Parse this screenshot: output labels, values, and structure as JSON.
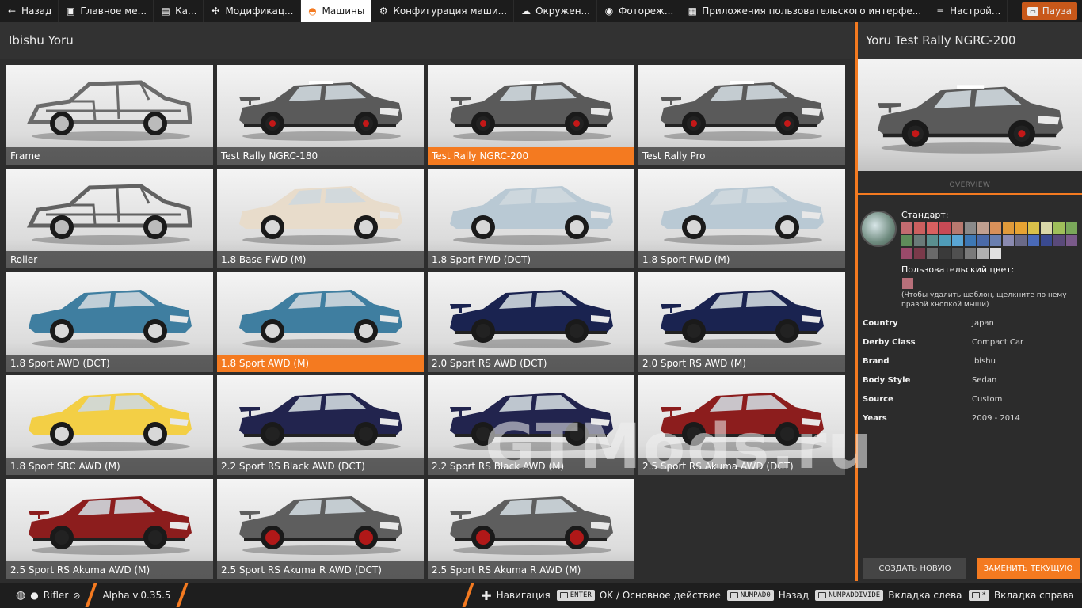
{
  "topbar": {
    "tabs": [
      {
        "label": "Назад",
        "icon": "back-arrow-icon",
        "active": false
      },
      {
        "label": "Главное ме...",
        "icon": "main-menu-icon",
        "active": false
      },
      {
        "label": "Ка...",
        "icon": "map-icon",
        "active": false
      },
      {
        "label": "Модификац...",
        "icon": "puzzle-icon",
        "active": false
      },
      {
        "label": "Машины",
        "icon": "car-icon",
        "active": true
      },
      {
        "label": "Конфигурация маши...",
        "icon": "engine-icon",
        "active": false
      },
      {
        "label": "Окружен...",
        "icon": "weather-icon",
        "active": false
      },
      {
        "label": "Фотореж...",
        "icon": "camera-icon",
        "active": false
      },
      {
        "label": "Приложения пользовательского интерфе...",
        "icon": "apps-icon",
        "active": false
      },
      {
        "label": "Настрой...",
        "icon": "settings-icon",
        "active": false
      }
    ],
    "pause_label": "Пауза"
  },
  "left": {
    "title": "Ibishu Yoru"
  },
  "configs": [
    {
      "label": "Frame",
      "body": "#6b6b6b",
      "style": "frame",
      "selected": false
    },
    {
      "label": "Test Rally NGRC-180",
      "body": "#5a5a5a",
      "style": "rally",
      "selected": false
    },
    {
      "label": "Test Rally NGRC-200",
      "body": "#5a5a5a",
      "style": "rally",
      "selected": true
    },
    {
      "label": "Test Rally Pro",
      "body": "#5a5a5a",
      "style": "rally",
      "selected": false
    },
    {
      "label": "Roller",
      "body": "#626262",
      "style": "frame",
      "selected": false
    },
    {
      "label": "1.8 Base FWD (M)",
      "body": "#e8dccb",
      "style": "sedan",
      "selected": false
    },
    {
      "label": "1.8 Sport FWD (DCT)",
      "body": "#b9c9d4",
      "style": "sedan",
      "selected": false
    },
    {
      "label": "1.8 Sport FWD (M)",
      "body": "#b9c9d4",
      "style": "sedan",
      "selected": false
    },
    {
      "label": "1.8 Sport AWD (DCT)",
      "body": "#3f7ea0",
      "style": "sedan",
      "selected": false
    },
    {
      "label": "1.8 Sport AWD (M)",
      "body": "#3f7ea0",
      "style": "sedan",
      "selected": true
    },
    {
      "label": "2.0 Sport RS AWD (DCT)",
      "body": "#1a2350",
      "style": "wing",
      "selected": false
    },
    {
      "label": "2.0 Sport RS AWD (M)",
      "body": "#1a2350",
      "style": "wing",
      "selected": false
    },
    {
      "label": "1.8 Sport SRC AWD (M)",
      "body": "#f3cf45",
      "style": "sedan",
      "selected": false
    },
    {
      "label": "2.2 Sport RS Black AWD (DCT)",
      "body": "#22244e",
      "style": "wing",
      "selected": false
    },
    {
      "label": "2.2 Sport RS Black AWD (M)",
      "body": "#22244e",
      "style": "wing",
      "selected": false
    },
    {
      "label": "2.5 Sport RS Akuma AWD (DCT)",
      "body": "#8c1d1d",
      "style": "wing",
      "selected": false
    },
    {
      "label": "2.5 Sport RS Akuma AWD (M)",
      "body": "#8c1d1d",
      "style": "wing",
      "selected": false
    },
    {
      "label": "2.5 Sport RS Akuma R AWD (DCT)",
      "body": "#5e5e5e",
      "style": "wing-red",
      "selected": false
    },
    {
      "label": "2.5 Sport RS Akuma R AWD (M)",
      "body": "#5e5e5e",
      "style": "wing-red",
      "selected": false
    }
  ],
  "right": {
    "title": "Yoru Test Rally NGRC-200",
    "overview_label": "OVERVIEW",
    "standard_label": "Стандарт:",
    "custom_label": "Пользовательский цвет:",
    "hint": "(Чтобы удалить шаблон, щелкните по нему правой кнопкой мыши)",
    "swatches": [
      "#c46b70",
      "#cc5f5f",
      "#d96060",
      "#c84a55",
      "#b8796f",
      "#8a8a8a",
      "#c0a090",
      "#d8905a",
      "#e09a3a",
      "#e7a332",
      "#d9c04a",
      "#d9d7a8",
      "#9fbf5a",
      "#7aa85a",
      "#5f8c5a",
      "#6a7a78",
      "#5a8f8f",
      "#4f9cb8",
      "#5aa6d4",
      "#3d78b5",
      "#4a6aa8",
      "#6a7fb0",
      "#8a8ab0",
      "#6a6a88",
      "#4a6ab8",
      "#3a4a90",
      "#5a4a7a",
      "#7a5a8a",
      "#9a4a6a",
      "#7a3a4a",
      "#6a6a6a",
      "#3a3a3a",
      "#505050",
      "#7a7a7a",
      "#b0b0b0",
      "#e0e0e0"
    ],
    "custom_color": "#b8707a",
    "properties": [
      {
        "key": "Country",
        "value": "Japan"
      },
      {
        "key": "Derby Class",
        "value": "Compact Car"
      },
      {
        "key": "Brand",
        "value": "Ibishu"
      },
      {
        "key": "Body Style",
        "value": "Sedan"
      },
      {
        "key": "Source",
        "value": "Custom"
      },
      {
        "key": "Years",
        "value": "2009 - 2014"
      }
    ],
    "btn_new": "СОЗДАТЬ НОВУЮ",
    "btn_replace": "ЗАМЕНИТЬ ТЕКУЩУЮ"
  },
  "watermark": "GTMods.ru",
  "bottombar": {
    "user": "Rifler",
    "version": "Alpha v.0.35.5",
    "hints": [
      {
        "key": "",
        "label": "Навигация",
        "icon": "dpad-icon"
      },
      {
        "key": "ENTER",
        "label": "OK / Основное действие"
      },
      {
        "key": "NUMPAD0",
        "label": "Назад"
      },
      {
        "key": "NUMPADDIVIDE",
        "label": "Вкладка слева"
      },
      {
        "key": "*",
        "label": "Вкладка справа"
      }
    ]
  }
}
